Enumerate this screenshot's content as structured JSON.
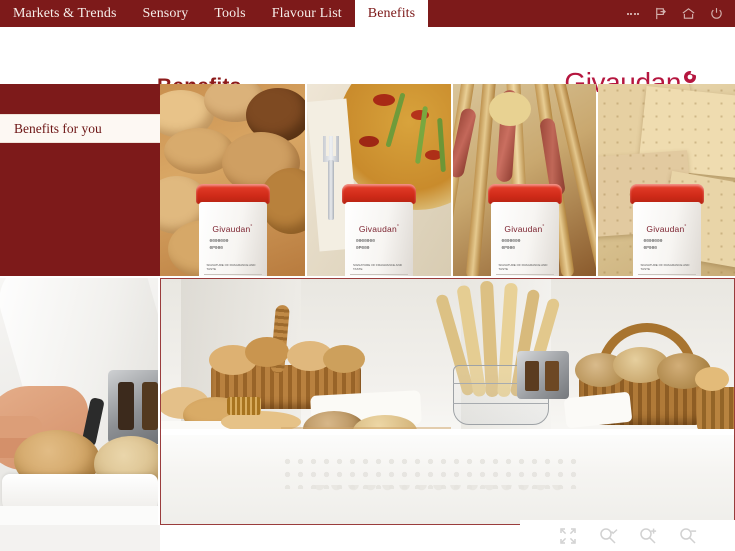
{
  "app": {
    "brand": "Givaudan",
    "brand_mark": "registered-circle-mark",
    "accent_dark_red": "#7d1a1a",
    "accent_title_red": "#8d1b1b",
    "accent_logo_magenta": "#b5163f",
    "panel_cream": "#fdf8f3"
  },
  "topnav": {
    "tabs": [
      {
        "label": "Markets & Trends",
        "active": false,
        "name": "tab-markets-trends"
      },
      {
        "label": "Sensory",
        "active": false,
        "name": "tab-sensory"
      },
      {
        "label": "Tools",
        "active": false,
        "name": "tab-tools"
      },
      {
        "label": "Flavour List",
        "active": false,
        "name": "tab-flavour-list"
      },
      {
        "label": "Benefits",
        "active": true,
        "name": "tab-benefits"
      }
    ],
    "icons": [
      {
        "name": "more-dots-icon",
        "glyph": "dots"
      },
      {
        "name": "logout-icon",
        "glyph": "exit-flag"
      },
      {
        "name": "home-icon",
        "glyph": "house"
      },
      {
        "name": "power-icon",
        "glyph": "power"
      }
    ]
  },
  "header": {
    "page_title": "Benefits"
  },
  "sidebar": {
    "items": [
      {
        "label": "Benefits for you",
        "active": true,
        "name": "sidebar-item-benefits-for-you"
      }
    ]
  },
  "jar": {
    "brand": "Givaudan",
    "mark": "°",
    "code_line_1": "0000000",
    "code_line_2": "0P000",
    "footer_text": "SIGNATURE OF FRAGRANCE AND TASTE",
    "strip_left": "0000 1 kg",
    "strip_right": "CODE 0000.00"
  },
  "gallery": {
    "panels": [
      {
        "name": "panel-bread-rolls",
        "caption": "Assorted seeded bread rolls with Givaudan jar"
      },
      {
        "name": "panel-pizza",
        "caption": "Pizza slice with fork and Givaudan jar"
      },
      {
        "name": "panel-breadsticks",
        "caption": "Breadsticks wrapped in cured ham with Givaudan jar"
      },
      {
        "name": "panel-crackers",
        "caption": "Crispbread crackers with Givaudan jar"
      },
      {
        "name": "panel-chef-hand-bread",
        "caption": "Chef's hand taking a bread roll from a dish"
      },
      {
        "name": "panel-bakery-table",
        "caption": "Bakery table with baskets of bread, baguettes and croissants"
      }
    ]
  },
  "toolbar": {
    "buttons": [
      {
        "name": "fullscreen-button",
        "label": "Fit to screen",
        "glyph": "expand-arrows"
      },
      {
        "name": "zoom-fit-button",
        "label": "Zoom fit",
        "glyph": "magnifier-check"
      },
      {
        "name": "zoom-in-button",
        "label": "Zoom in",
        "glyph": "magnifier-plus"
      },
      {
        "name": "zoom-out-button",
        "label": "Zoom out",
        "glyph": "magnifier-minus"
      }
    ]
  }
}
